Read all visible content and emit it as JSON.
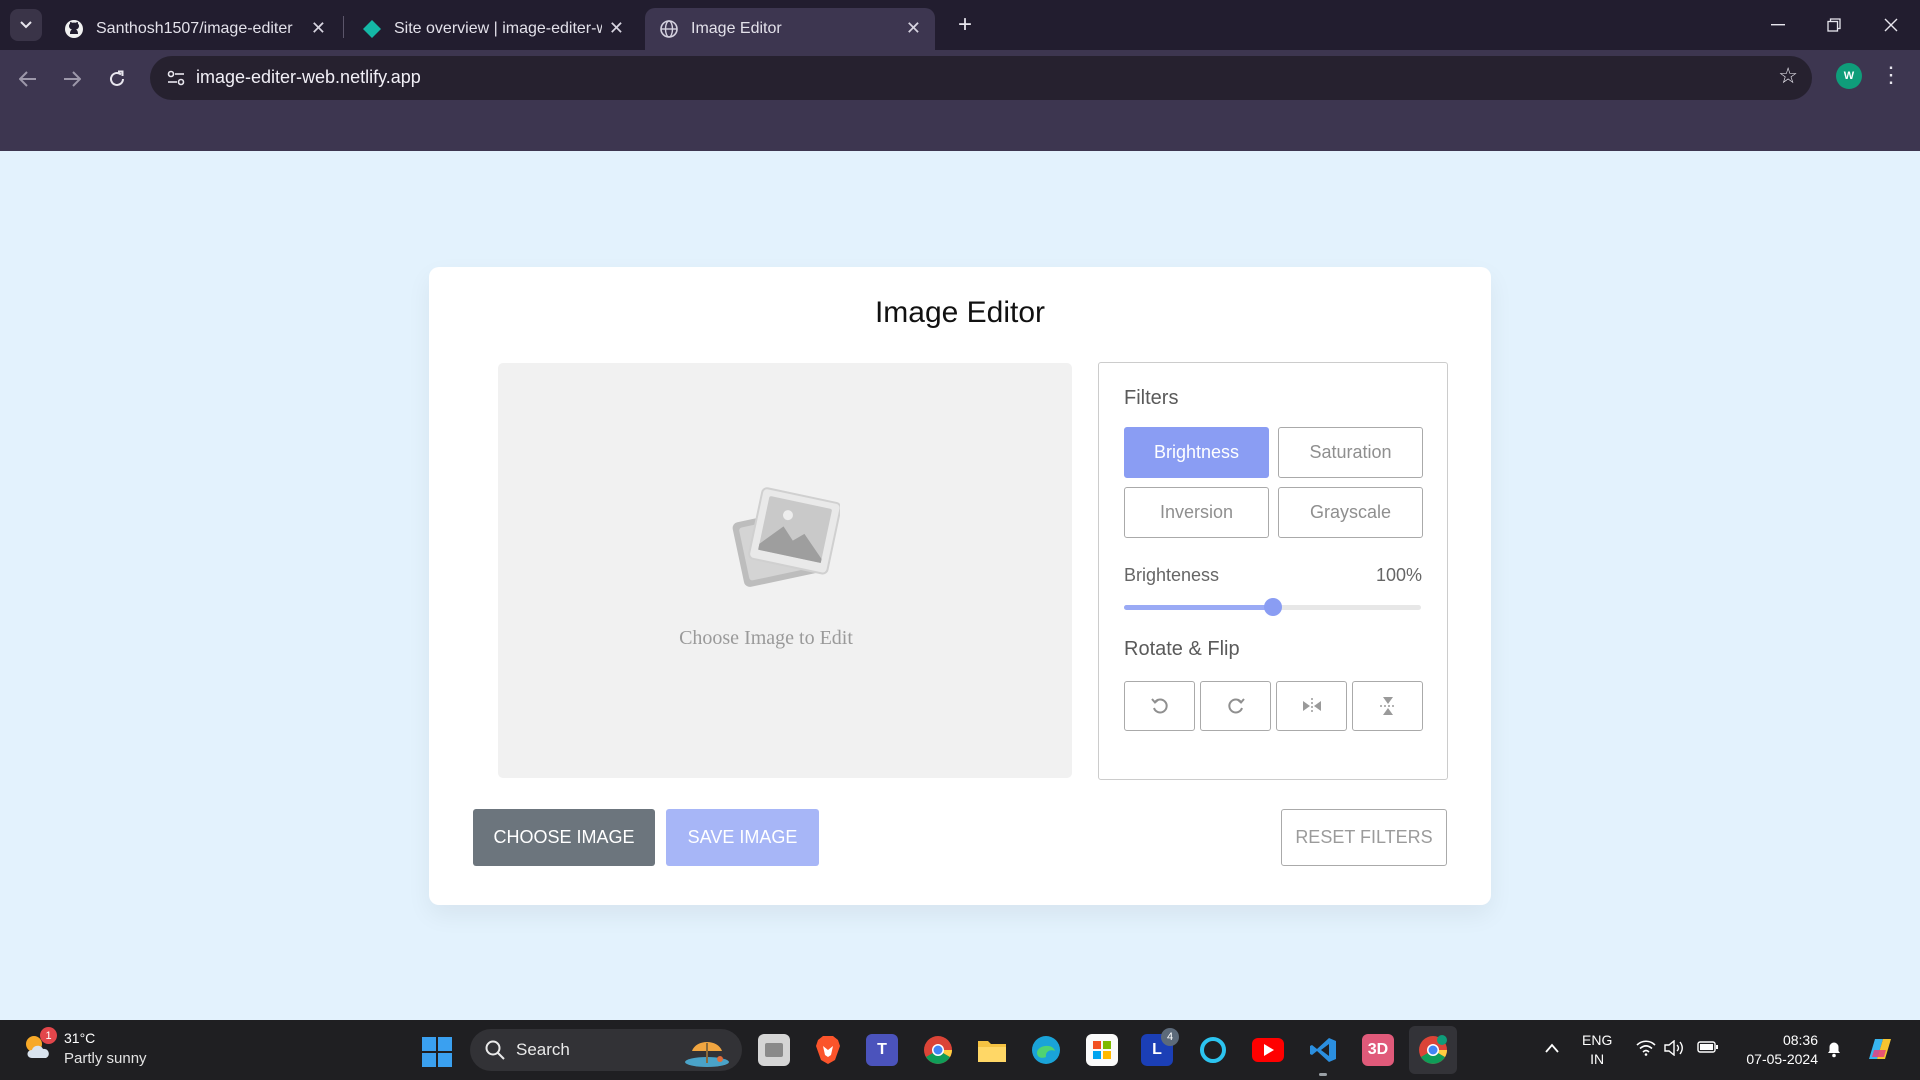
{
  "browser": {
    "tabs": [
      {
        "title": "Santhosh1507/image-editer",
        "icon": "github-icon"
      },
      {
        "title": "Site overview | image-editer-we",
        "icon": "netlify-icon"
      },
      {
        "title": "Image Editor",
        "icon": "globe-icon",
        "active": true
      }
    ],
    "url": "image-editer-web.netlify.app",
    "profile_initial": "W"
  },
  "editor": {
    "title": "Image Editor",
    "preview_placeholder": "Choose Image to Edit",
    "filters_label": "Filters",
    "filter_buttons": [
      "Brightness",
      "Saturation",
      "Inversion",
      "Grayscale"
    ],
    "active_filter": "Brightness",
    "slider_name": "Brighteness",
    "slider_value_text": "100%",
    "slider_fraction": 0.5,
    "rotate_flip_label": "Rotate & Flip",
    "rotate_buttons": [
      "rotate-left-icon",
      "rotate-right-icon",
      "flip-horizontal-icon",
      "flip-vertical-icon"
    ],
    "choose_label": "CHOOSE IMAGE",
    "save_label": "SAVE IMAGE",
    "reset_label": "RESET FILTERS",
    "colors": {
      "accent": "#8a9df3",
      "choose": "#6c757d",
      "page_bg": "#e3f2fd"
    }
  },
  "taskbar": {
    "weather": {
      "badge": "1",
      "temp": "31°C",
      "desc": "Partly sunny"
    },
    "search_label": "Search",
    "l_badge": "4",
    "lang_1": "ENG",
    "lang_2": "IN",
    "time": "08:36",
    "date": "07-05-2024"
  }
}
